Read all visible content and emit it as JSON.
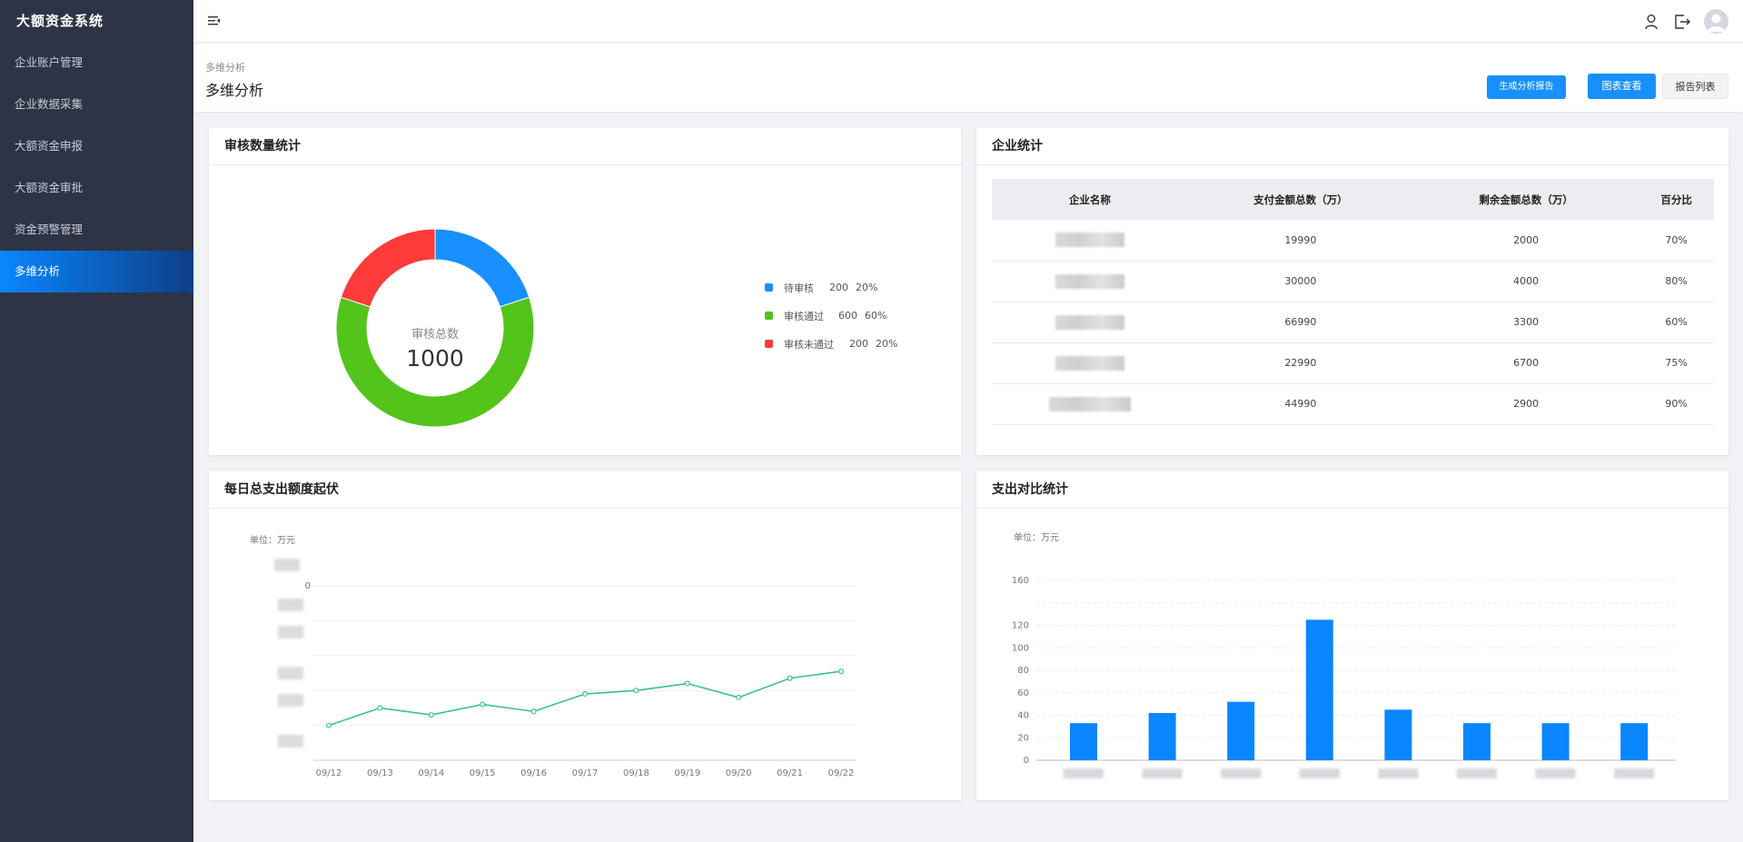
{
  "app": {
    "title": "大额资金系统"
  },
  "sidebar": {
    "items": [
      {
        "label": "企业账户管理"
      },
      {
        "label": "企业数据采集"
      },
      {
        "label": "大额资金申报"
      },
      {
        "label": "大额资金审批"
      },
      {
        "label": "资金预警管理"
      },
      {
        "label": "多维分析",
        "active": true
      }
    ]
  },
  "header": {
    "icons": [
      "menu-fold-icon",
      "user-icon",
      "logout-icon",
      "avatar-icon"
    ]
  },
  "page": {
    "breadcrumb": "多维分析",
    "title": "多维分析",
    "buttons": {
      "generate": "生成分析报告",
      "chart_view": "图表查看",
      "report_list": "报告列表"
    }
  },
  "audit_card": {
    "title": "审核数量统计",
    "center_label": "审核总数",
    "center_value": "1000",
    "legend": [
      {
        "label": "待审核",
        "count": "200",
        "pct": "20%",
        "color": "#1890ff",
        "value": 200
      },
      {
        "label": "审核通过",
        "count": "600",
        "pct": "60%",
        "color": "#52c41a",
        "value": 600
      },
      {
        "label": "审核未通过",
        "count": "200",
        "pct": "20%",
        "color": "#ff3b3b",
        "value": 200
      }
    ]
  },
  "company_card": {
    "title": "企业统计",
    "columns": [
      "企业名称",
      "支付金额总数（万）",
      "剩余金额总数（万）",
      "百分比"
    ],
    "rows": [
      {
        "pay": "19990",
        "remain": "2000",
        "pct": "70%"
      },
      {
        "pay": "30000",
        "remain": "4000",
        "pct": "80%"
      },
      {
        "pay": "66990",
        "remain": "3300",
        "pct": "60%"
      },
      {
        "pay": "22990",
        "remain": "6700",
        "pct": "75%"
      },
      {
        "pay": "44990",
        "remain": "2900",
        "pct": "90%"
      }
    ]
  },
  "daily_card": {
    "title": "每日总支出额度起伏",
    "unit": "单位：万元"
  },
  "compare_card": {
    "title": "支出对比统计",
    "unit": "单位：万元"
  },
  "chart_data": [
    {
      "type": "pie",
      "title": "审核数量统计",
      "labels": [
        "待审核",
        "审核通过",
        "审核未通过"
      ],
      "values": [
        200,
        600,
        200
      ],
      "colors": [
        "#1890ff",
        "#52c41a",
        "#ff3b3b"
      ]
    },
    {
      "type": "line",
      "title": "每日总支出额度起伏",
      "x": [
        "09/12",
        "09/13",
        "09/14",
        "09/15",
        "09/16",
        "09/17",
        "09/18",
        "09/19",
        "09/20",
        "09/21",
        "09/22"
      ],
      "values": [
        1.0,
        1.5,
        1.3,
        1.6,
        1.4,
        1.9,
        2.0,
        2.2,
        1.8,
        2.35,
        2.55
      ],
      "ylim": [
        0,
        5
      ],
      "color": "#3cc18a",
      "grid": true
    },
    {
      "type": "bar",
      "title": "支出对比统计",
      "values": [
        33,
        42,
        52,
        125,
        45,
        33,
        33,
        33
      ],
      "ylim": [
        0,
        160
      ],
      "yticks": [
        0,
        20,
        40,
        60,
        80,
        100,
        120,
        160
      ],
      "color": "#0a86ff",
      "grid": true
    }
  ]
}
